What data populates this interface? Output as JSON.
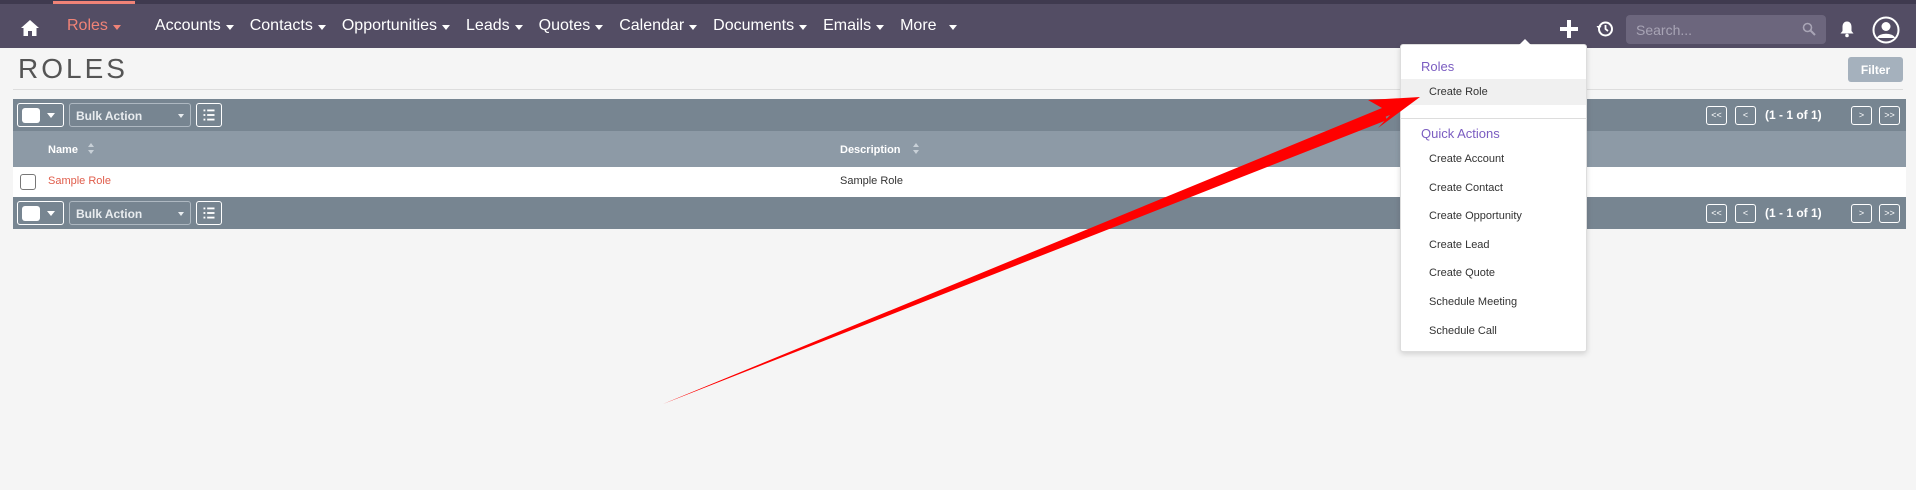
{
  "nav": {
    "home_icon": "home-icon",
    "items": [
      {
        "label": "Roles",
        "active": true
      },
      {
        "label": "Accounts"
      },
      {
        "label": "Contacts"
      },
      {
        "label": "Opportunities"
      },
      {
        "label": "Leads"
      },
      {
        "label": "Quotes"
      },
      {
        "label": "Calendar"
      },
      {
        "label": "Documents"
      },
      {
        "label": "Emails"
      },
      {
        "label": "More"
      }
    ],
    "search_placeholder": "Search...",
    "active_color": "#f08377",
    "bar_color": "#534d64"
  },
  "header": {
    "title": "ROLES",
    "filter_label": "Filter"
  },
  "list": {
    "bulk_action_label": "Bulk Action",
    "pagination": {
      "first": "<<",
      "prev": "<",
      "summary": "(1 - 1 of 1)",
      "next": ">",
      "last": ">>"
    },
    "columns": [
      "Name",
      "Description"
    ],
    "rows": [
      {
        "name": "Sample Role",
        "description": "Sample Role"
      }
    ]
  },
  "dropdown": {
    "section_title": "Roles",
    "section_items": [
      "Create Role"
    ],
    "quick_title": "Quick Actions",
    "quick_items": [
      "Create Account",
      "Create Contact",
      "Create Opportunity",
      "Create Lead",
      "Create Quote",
      "Schedule Meeting",
      "Schedule Call"
    ]
  },
  "annotation": {
    "arrow_color": "#ff0000"
  }
}
